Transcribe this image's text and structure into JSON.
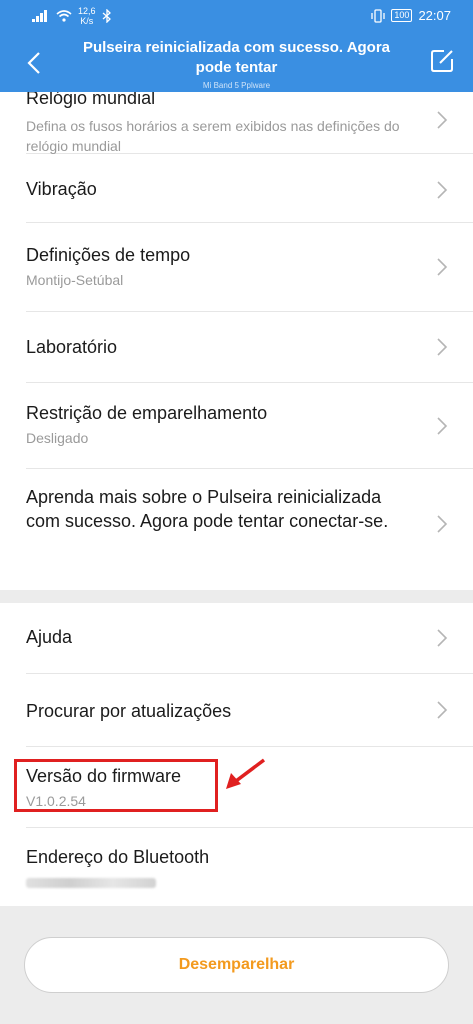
{
  "status_bar": {
    "speed_value": "12,6",
    "speed_unit": "K/s",
    "battery": "100",
    "time": "22:07"
  },
  "header": {
    "title": "Pulseira reinicializada com sucesso. Agora pode tentar",
    "subtitle": "Mi Band 5 Pplware",
    "back_icon": "back-arrow-icon",
    "edit_icon": "edit-icon"
  },
  "settings": [
    {
      "title": "Relógio mundial",
      "subtitle": "Defina os fusos horários a serem exibidos nas definições do relógio mundial",
      "chevron": true
    },
    {
      "title": "Vibração",
      "subtitle": "",
      "chevron": true
    },
    {
      "title": "Definições de tempo",
      "subtitle": "Montijo-Setúbal",
      "chevron": true
    },
    {
      "title": "Laboratório",
      "subtitle": "",
      "chevron": true
    },
    {
      "title": "Restrição de emparelhamento",
      "subtitle": "Desligado",
      "chevron": true
    },
    {
      "title": "Aprenda mais sobre o Pulseira reinicializada com sucesso. Agora pode tentar conectar-se.",
      "subtitle": "",
      "chevron": true
    }
  ],
  "about": [
    {
      "title": "Ajuda",
      "subtitle": "",
      "chevron": true
    },
    {
      "title": "Procurar por atualizações",
      "subtitle": "",
      "chevron": true
    },
    {
      "title": "Versão do firmware",
      "subtitle": "V1.0.2.54",
      "chevron": false
    },
    {
      "title": "Endereço do Bluetooth",
      "subtitle": "",
      "chevron": false
    }
  ],
  "unpair_button": "Desemparelhar",
  "colors": {
    "header": "#3a8fe2",
    "accent_orange": "#f39a1e",
    "highlight_red": "#e02020"
  }
}
